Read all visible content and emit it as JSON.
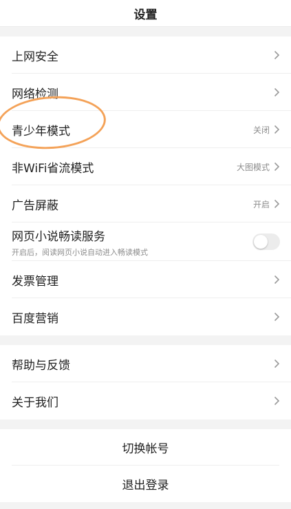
{
  "header": {
    "title": "设置"
  },
  "section1": [
    {
      "label": "上网安全",
      "value": ""
    },
    {
      "label": "网络检测",
      "value": ""
    },
    {
      "label": "青少年模式",
      "value": "关闭"
    },
    {
      "label": "非WiFi省流模式",
      "value": "大图模式"
    },
    {
      "label": "广告屏蔽",
      "value": "开启"
    },
    {
      "label": "网页小说畅读服务",
      "sub": "开启后，阅读网页小说自动进入畅读模式",
      "toggle_on": false
    },
    {
      "label": "发票管理",
      "value": ""
    },
    {
      "label": "百度营销",
      "value": ""
    }
  ],
  "section2": [
    {
      "label": "帮助与反馈"
    },
    {
      "label": "关于我们"
    }
  ],
  "actions": {
    "switch_account": "切换帐号",
    "logout": "退出登录"
  },
  "colors": {
    "annotation_ring": "#f4a258",
    "background": "#f3f3f3"
  }
}
